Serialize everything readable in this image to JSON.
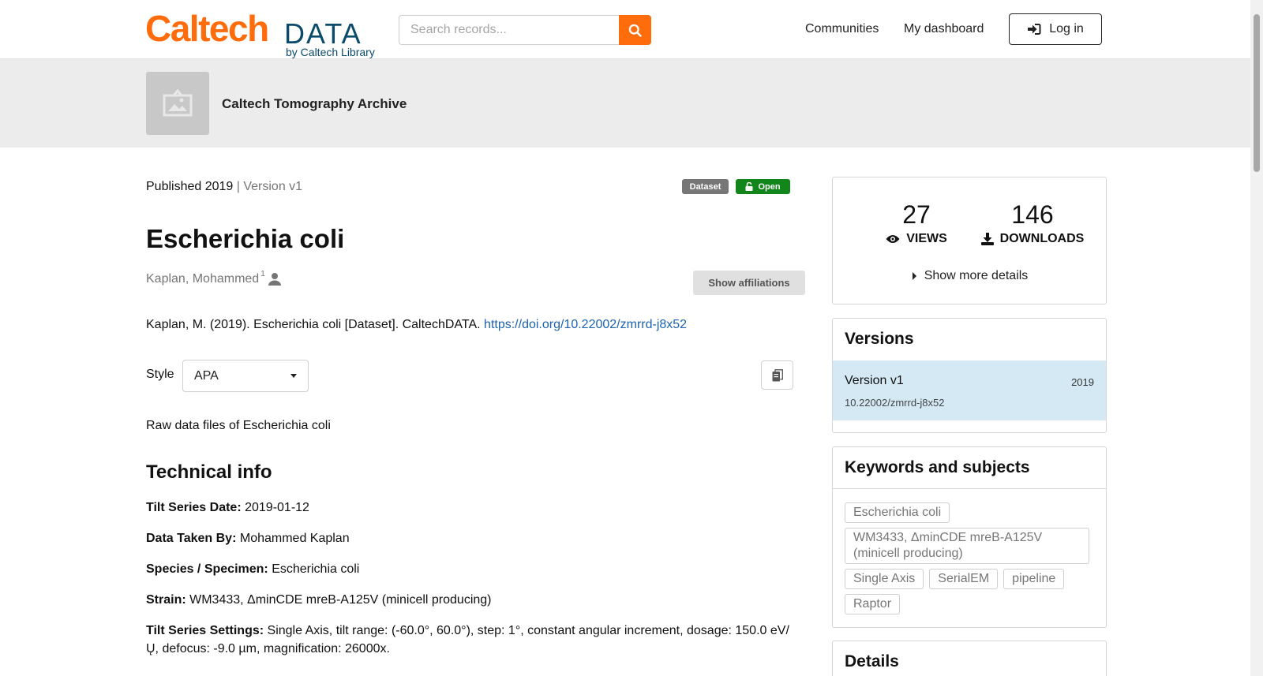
{
  "header": {
    "logo_main": "Caltech",
    "logo_data": "DATA",
    "logo_sub": "by Caltech Library",
    "search_placeholder": "Search records...",
    "nav": [
      "Communities",
      "My dashboard"
    ],
    "login_label": "Log in"
  },
  "community": {
    "name": "Caltech Tomography Archive"
  },
  "record": {
    "published": "Published 2019",
    "version_sep": " | Version v1",
    "badge_type": "Dataset",
    "badge_access": "Open",
    "title": "Escherichia coli",
    "author": "Kaplan, Mohammed",
    "author_sup": "1",
    "show_affiliations": "Show affiliations",
    "citation_text": "Kaplan, M. (2019). Escherichia coli [Dataset]. CaltechDATA.",
    "citation_link": "https://doi.org/10.22002/zmrrd-j8x52",
    "style_label": "Style",
    "style_value": "APA",
    "description": "Raw data files of Escherichia coli",
    "tech_heading": "Technical info",
    "tech": [
      {
        "label": "Tilt Series Date:",
        "value": "2019-01-12"
      },
      {
        "label": "Data Taken By:",
        "value": "Mohammed Kaplan"
      },
      {
        "label": "Species / Specimen:",
        "value": "Escherichia coli"
      },
      {
        "label": "Strain:",
        "value": "WM3433, ΔminCDE mreB-A125V (minicell producing)"
      },
      {
        "label": "Tilt Series Settings:",
        "value": "Single Axis, tilt range: (-60.0°, 60.0°), step: 1°, constant angular increment, dosage: 150.0 eV/Ų, defocus: -9.0 µm, magnification: 26000x."
      }
    ]
  },
  "sidebar": {
    "views_count": "27",
    "views_label": "VIEWS",
    "downloads_count": "146",
    "downloads_label": "DOWNLOADS",
    "show_more": "Show more details",
    "versions_heading": "Versions",
    "version_name": "Version v1",
    "version_year": "2019",
    "version_doi": "10.22002/zmrrd-j8x52",
    "keywords_heading": "Keywords and subjects",
    "keywords": [
      "Escherichia coli",
      "WM3433, ΔminCDE mreB-A125V (minicell producing)",
      "Single Axis",
      "SerialEM",
      "pipeline",
      "Raptor"
    ],
    "details_heading": "Details"
  },
  "colors": {
    "brand_orange": "#ff6c0c",
    "brand_blue": "#0a4a6b",
    "open_green": "#12851b",
    "link_blue": "#1b63b0",
    "version_highlight": "#d5e9f5"
  }
}
